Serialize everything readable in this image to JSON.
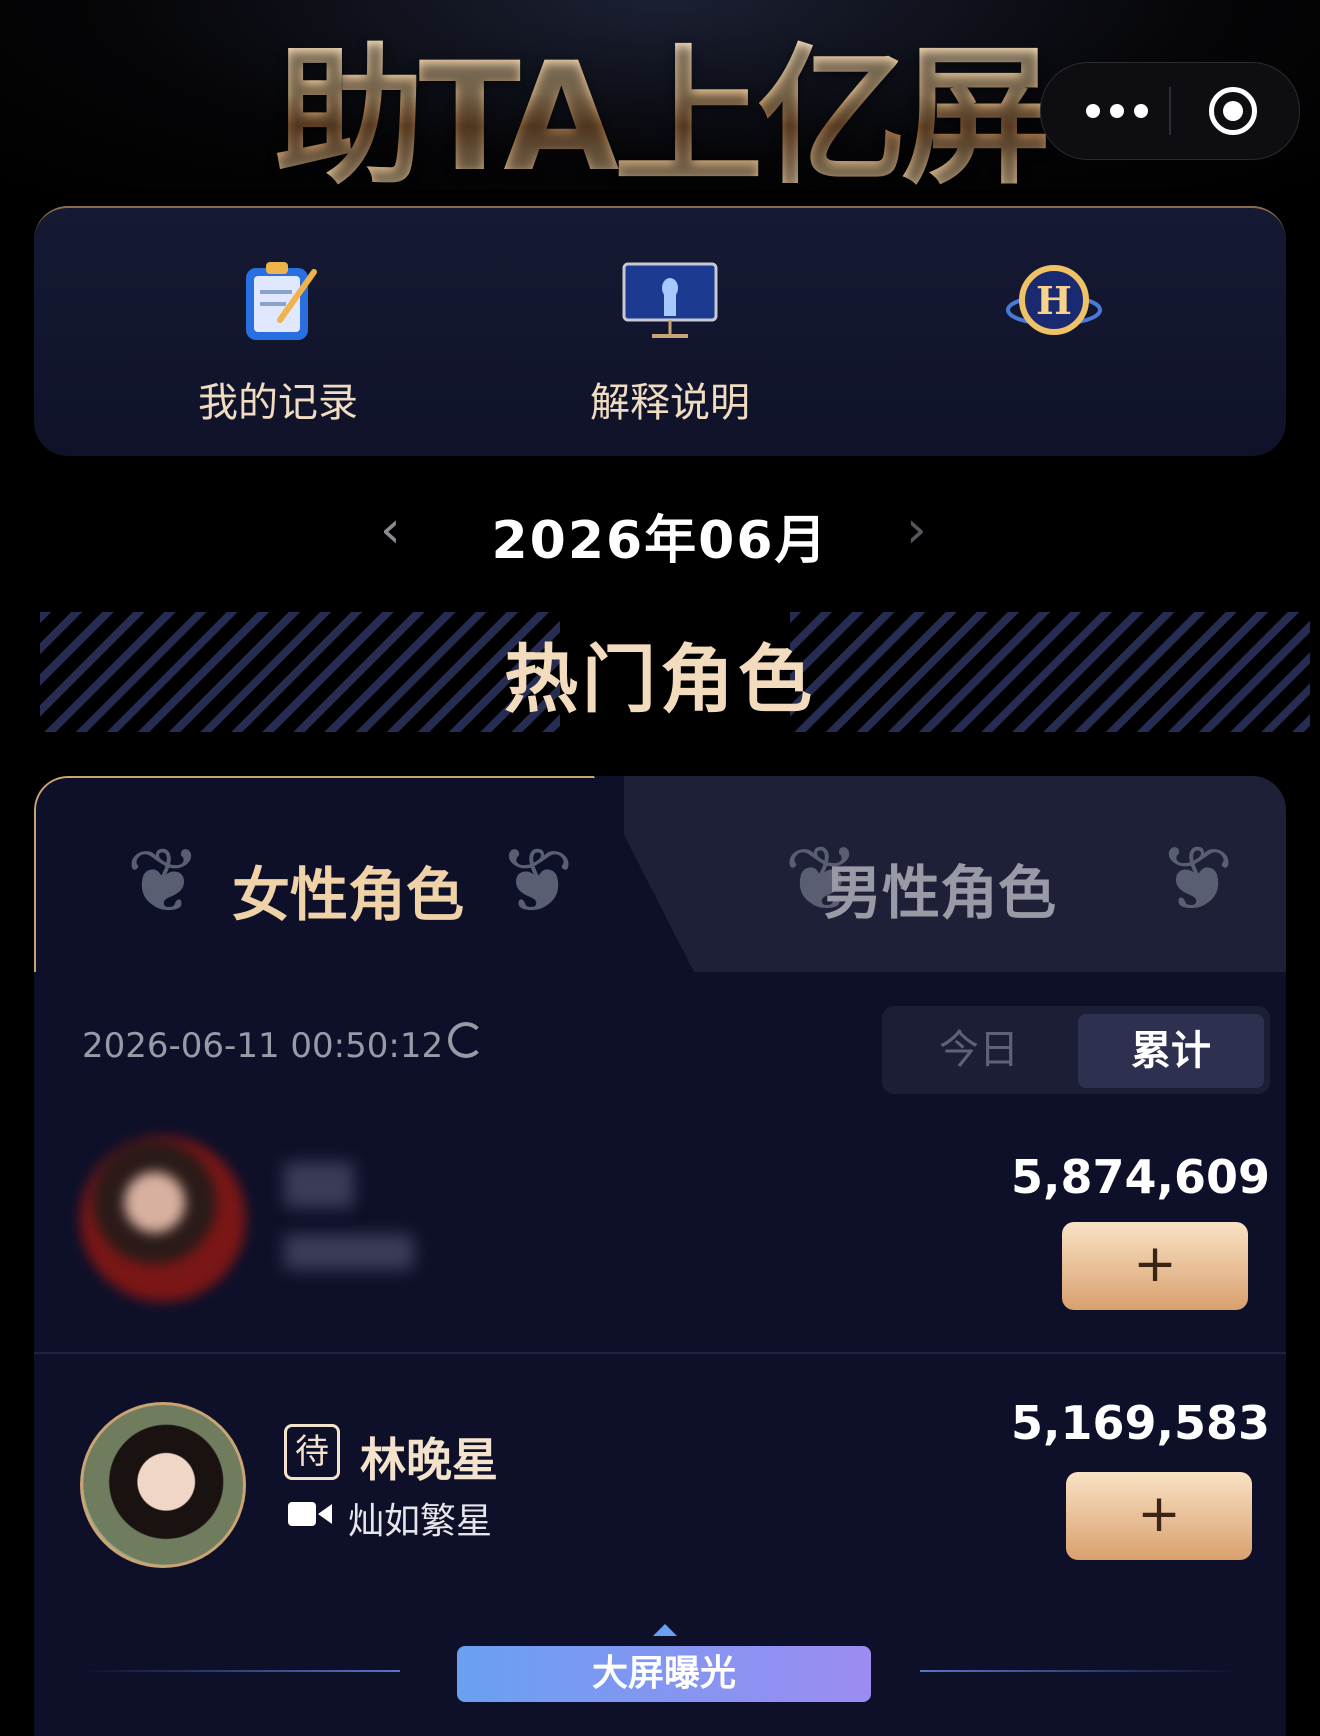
{
  "header": {
    "title": "助TA上亿屏"
  },
  "quick_menu": {
    "items": [
      {
        "label": "我的记录",
        "icon": "clipboard-icon"
      },
      {
        "label": "解释说明",
        "icon": "monitor-icon"
      },
      {
        "label": "",
        "icon": "h-badge-icon"
      }
    ]
  },
  "month": {
    "label": "2026年06月"
  },
  "section": {
    "title": "热门角色"
  },
  "tabs": {
    "female": "女性角色",
    "male": "男性角色"
  },
  "list": {
    "timestamp": "2026-06-11 00:50:12",
    "toggle": {
      "today": "今日",
      "total": "累计"
    },
    "rows": [
      {
        "name": "",
        "work": "",
        "score": "5,874,609",
        "add": "+"
      },
      {
        "badge": "待",
        "name": "林晚星",
        "work": "灿如繁星",
        "score": "5,169,583",
        "add": "+"
      }
    ]
  },
  "footer": {
    "button": "大屏曝光"
  },
  "colors": {
    "gold": "#f4e3cc",
    "panel": "#0e1029",
    "accent": "#9c8cf2"
  }
}
